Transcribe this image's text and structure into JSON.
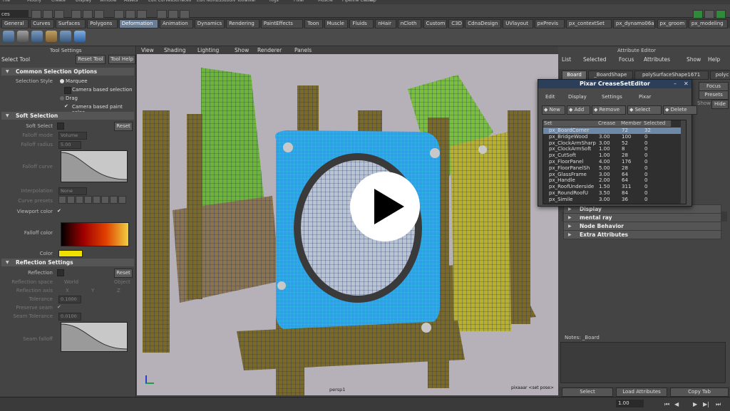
{
  "menubar": {
    "items": [
      "File",
      "Modify",
      "Create",
      "Display",
      "Window",
      "Assets",
      "Edit Curves",
      "Surfaces",
      "Edit NURBS",
      "Subdiv Tools",
      "Pixar",
      "Rigs",
      "Pixar",
      "Muscle",
      "Pipeline Cache",
      "Help"
    ]
  },
  "toolbar": {
    "mode_value": "ces"
  },
  "shelf_tabs": [
    "General",
    "Curves",
    "Surfaces",
    "Polygons",
    "Deformation",
    "Animation",
    "Dynamics",
    "Rendering",
    "PaintEffects",
    "Toon",
    "Muscle",
    "Fluids",
    "nHair",
    "nCloth",
    "Custom",
    "C3D",
    "CdnaDesign",
    "UVlayout",
    "pxPrevis",
    "px_contextSet",
    "px_dynamo06a",
    "px_groom",
    "px_modeling"
  ],
  "shelf_active": "Deformation",
  "tool_settings": {
    "header_left": "Select Tool",
    "header_center": "Tool Settings",
    "reset_button": "Reset Tool",
    "help_button": "Tool Help",
    "common": {
      "title": "Common Selection Options",
      "selection_style_label": "Selection Style",
      "marquee": "Marquee",
      "camera_based": "Camera based selection",
      "drag": "Drag",
      "camera_paint": "Camera based paint selec"
    },
    "soft": {
      "title": "Soft Selection",
      "soft_select_label": "Soft Select",
      "reset": "Reset",
      "falloff_mode_label": "Falloff mode",
      "falloff_mode_value": "Volume",
      "falloff_radius_label": "Falloff radius",
      "falloff_radius_value": "5.00",
      "falloff_curve_label": "Falloff curve",
      "interpolation_label": "Interpolation",
      "interpolation_value": "None",
      "curve_presets_label": "Curve presets",
      "viewport_color_label": "Viewport color",
      "falloff_color_label": "Falloff color",
      "color_label": "Color"
    },
    "reflection": {
      "title": "Reflection Settings",
      "reflection_label": "Reflection",
      "reset": "Reset",
      "space_label": "Reflection space",
      "space_world": "World",
      "space_object": "Object",
      "axis_label": "Reflection axis",
      "axis_x": "X",
      "axis_y": "Y",
      "axis_z": "Z",
      "tolerance_label": "Tolerance",
      "tolerance_value": "0.1000",
      "preserve_seam_label": "Preserve seam",
      "seam_tolerance_label": "Seam Tolerance",
      "seam_tolerance_value": "0.0100",
      "seam_falloff_label": "Seam falloff"
    }
  },
  "viewport": {
    "menu": [
      "View",
      "Shading",
      "Lighting",
      "Show",
      "Renderer",
      "Panels"
    ],
    "camera_label": "persp1",
    "hud_label": "pixaaar <set pose>"
  },
  "attribute_editor": {
    "title": "Attribute Editor",
    "menu": [
      "List",
      "Selected",
      "Focus",
      "Attributes",
      "Show",
      "Help"
    ],
    "node_tabs": [
      "Board",
      "_BoardShape",
      "polySurfaceShape1671",
      "polyc"
    ],
    "focus_button": "Focus",
    "presets_button": "Presets",
    "show_label": "Show",
    "hide_label": "Hide",
    "sections": [
      "Display",
      "mental ray",
      "Node Behavior",
      "Extra Attributes"
    ],
    "notes_label": "Notes: _Board",
    "bottom_buttons": [
      "Select",
      "Load Attributes",
      "Copy Tab"
    ]
  },
  "crease_editor": {
    "title": "Pixar CreaseSetEditor",
    "menu": [
      "Edit",
      "Display",
      "Settings",
      "Pixar"
    ],
    "buttons": [
      "New",
      "Add",
      "Remove",
      "Select",
      "Delete"
    ],
    "columns": [
      "Set",
      "Crease",
      "Member",
      "Selected"
    ],
    "rows": [
      {
        "set": "px_BoardCorner",
        "crease": "",
        "member": "72",
        "selected": "32",
        "highlight": true
      },
      {
        "set": "px_BridgeWood",
        "crease": "3.00",
        "member": "100",
        "selected": "0",
        "highlight": false
      },
      {
        "set": "px_ClockArmSharp",
        "crease": "3.00",
        "member": "52",
        "selected": "0",
        "highlight": false
      },
      {
        "set": "px_ClockArmSoft",
        "crease": "1.00",
        "member": "8",
        "selected": "0",
        "highlight": false
      },
      {
        "set": "px_CutSoft",
        "crease": "1.00",
        "member": "28",
        "selected": "0",
        "highlight": false
      },
      {
        "set": "px_FloorPanel",
        "crease": "4.00",
        "member": "176",
        "selected": "0",
        "highlight": false
      },
      {
        "set": "px_FloorPanelSh",
        "crease": "5.00",
        "member": "28",
        "selected": "0",
        "highlight": false
      },
      {
        "set": "px_GlassFrame",
        "crease": "3.00",
        "member": "64",
        "selected": "0",
        "highlight": false
      },
      {
        "set": "px_Handle",
        "crease": "2.00",
        "member": "64",
        "selected": "0",
        "highlight": false
      },
      {
        "set": "px_RoofUnderside",
        "crease": "1.50",
        "member": "311",
        "selected": "0",
        "highlight": false
      },
      {
        "set": "px_RoundRoofU",
        "crease": "3.50",
        "member": "84",
        "selected": "0",
        "highlight": false
      },
      {
        "set": "px_Simile",
        "crease": "3.00",
        "member": "36",
        "selected": "0",
        "highlight": false
      }
    ]
  },
  "timeline": {
    "current_value": "1.00"
  },
  "colors": {
    "accent": "#6a7d92",
    "selection_mesh": "#2fa0e8",
    "wood": "#7a6a2a",
    "play_overlay": "#ffffff"
  }
}
